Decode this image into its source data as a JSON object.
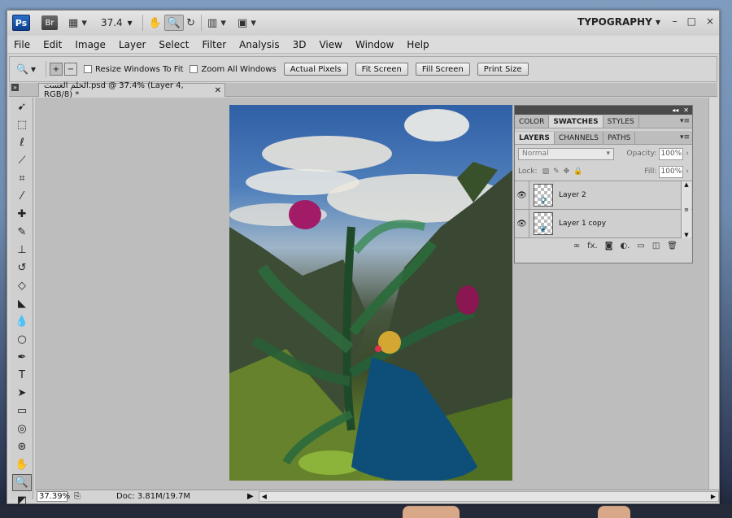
{
  "app": {
    "logo": "Ps",
    "bridge": "Br",
    "zoom": "37.4",
    "workspace": "TYPOGRAPHY",
    "window_controls": [
      "–",
      "□",
      "×"
    ]
  },
  "menu": [
    "File",
    "Edit",
    "Image",
    "Layer",
    "Select",
    "Filter",
    "Analysis",
    "3D",
    "View",
    "Window",
    "Help"
  ],
  "options": {
    "resize_windows": "Resize Windows To Fit",
    "zoom_all": "Zoom All Windows",
    "actual_pixels": "Actual Pixels",
    "fit_screen": "Fit Screen",
    "fill_screen": "Fill Screen",
    "print_size": "Print Size"
  },
  "document": {
    "tab_title": "الحلم العست.psd @ 37.4% (Layer 4, RGB/8) *",
    "zoom_field": "37.39%",
    "doc_size": "Doc: 3.81M/19.7M"
  },
  "panel": {
    "top_tabs": [
      "COLOR",
      "SWATCHES",
      "STYLES"
    ],
    "active_top_tab": "SWATCHES",
    "bottom_tabs": [
      "LAYERS",
      "CHANNELS",
      "PATHS"
    ],
    "active_bottom_tab": "LAYERS",
    "blend_mode": "Normal",
    "opacity_label": "Opacity:",
    "opacity_value": "100%",
    "lock_label": "Lock:",
    "fill_label": "Fill:",
    "fill_value": "100%",
    "layers": [
      {
        "name": "Layer 2"
      },
      {
        "name": "Layer 1 copy"
      }
    ]
  },
  "colors": {
    "accent": "#1b5ea8",
    "panel_bg": "#d2d2d2",
    "canvas_bg": "#bdbdbd"
  },
  "icons": [
    "zoom-icon",
    "hand-icon",
    "rotate-view-icon",
    "arrange-documents-icon",
    "screen-mode-icon",
    "eye-icon",
    "link-icon",
    "fx-icon",
    "mask-icon",
    "adjustment-icon",
    "group-icon",
    "new-layer-icon",
    "trash-icon"
  ]
}
